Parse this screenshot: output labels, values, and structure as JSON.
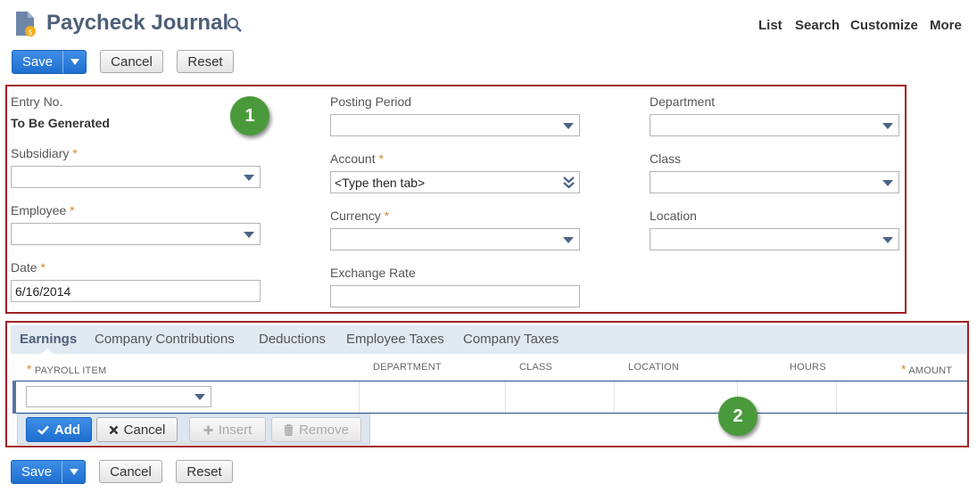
{
  "header": {
    "title": "Paycheck Journal",
    "nav": [
      "List",
      "Search",
      "Customize",
      "More"
    ]
  },
  "toolbar": {
    "save_label": "Save",
    "cancel_label": "Cancel",
    "reset_label": "Reset"
  },
  "form": {
    "entry_no_label": "Entry No.",
    "entry_no_value": "To Be Generated",
    "subsidiary_label": "Subsidiary",
    "employee_label": "Employee",
    "date_label": "Date",
    "date_value": "6/16/2014",
    "posting_period_label": "Posting Period",
    "account_label": "Account",
    "account_value": "<Type then tab>",
    "currency_label": "Currency",
    "exchange_rate_label": "Exchange Rate",
    "department_label": "Department",
    "class_label": "Class",
    "location_label": "Location",
    "required_mark": "*"
  },
  "callouts": [
    "1",
    "2"
  ],
  "tabs": [
    "Earnings",
    "Company Contributions",
    "Deductions",
    "Employee Taxes",
    "Company Taxes"
  ],
  "grid": {
    "columns": [
      "PAYROLL ITEM",
      "DEPARTMENT",
      "CLASS",
      "LOCATION",
      "HOURS",
      "AMOUNT"
    ]
  },
  "line_actions": {
    "add": "Add",
    "cancel": "Cancel",
    "insert": "Insert",
    "remove": "Remove"
  },
  "colors": {
    "accent": "#1e6fd0",
    "callout_border": "#a11f25",
    "callout_badge": "#4a9a3c",
    "required": "#d28a2c"
  }
}
